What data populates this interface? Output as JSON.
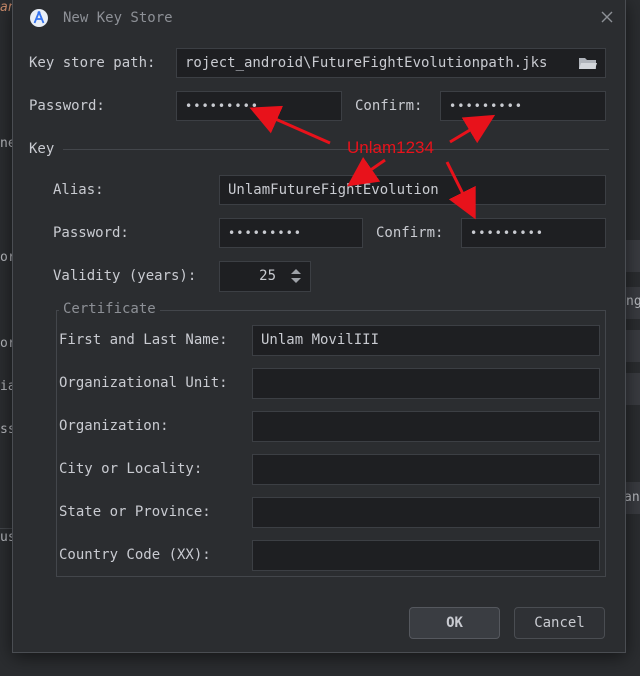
{
  "background": {
    "fragments": [
      "ando",
      "ne",
      "or",
      "or",
      "ia",
      "ss",
      "us",
      "ng",
      "and"
    ]
  },
  "dialog": {
    "title": "New Key Store",
    "keystore": {
      "path_label": "Key store path:",
      "path_value": "roject_android\\FutureFightEvolutionpath.jks",
      "password_label": "Password:",
      "password_value": "•••••••••",
      "confirm_label": "Confirm:",
      "confirm_value": "•••••••••"
    },
    "key": {
      "section_label": "Key",
      "alias_label": "Alias:",
      "alias_value": "UnlamFutureFightEvolution",
      "password_label": "Password:",
      "password_value": "•••••••••",
      "confirm_label": "Confirm:",
      "confirm_value": "•••••••••",
      "validity_label": "Validity (years):",
      "validity_value": "25"
    },
    "certificate": {
      "legend": "Certificate",
      "first_last_label": "First and Last Name:",
      "first_last_value": "Unlam MovilIII",
      "org_unit_label": "Organizational Unit:",
      "org_label": "Organization:",
      "city_label": "City or Locality:",
      "state_label": "State or Province:",
      "country_label": "Country Code (XX):"
    },
    "buttons": {
      "ok": "OK",
      "cancel": "Cancel"
    }
  },
  "annotation": {
    "text": "Unlam1234",
    "color": "#e8121b"
  },
  "colors": {
    "field_bg": "#1e1f22",
    "dialog_bg": "#2b2d30",
    "accent": "#3574f0"
  }
}
